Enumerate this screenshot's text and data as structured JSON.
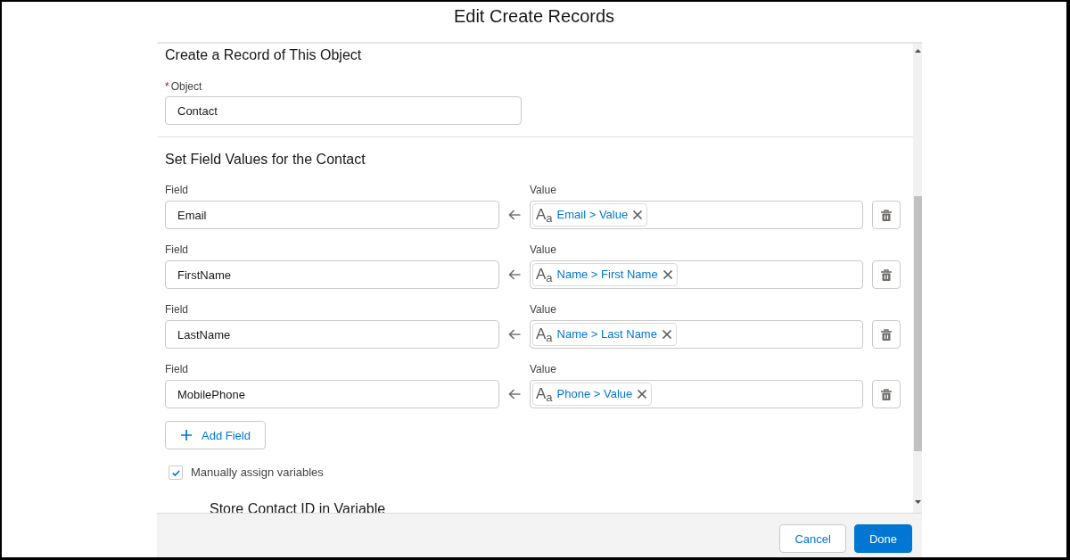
{
  "dialog": {
    "title": "Edit Create Records"
  },
  "record_section": {
    "heading": "Create a Record of This Object",
    "object_field": {
      "label": "Object",
      "required_mark": "*",
      "value": "Contact"
    }
  },
  "field_values_section": {
    "heading": "Set Field Values for the Contact",
    "rows": [
      {
        "field_label": "Field",
        "field": "Email",
        "value_label": "Value",
        "value": {
          "type_icon": "A$_{a}$",
          "reference": "Email > Value"
        }
      },
      {
        "field_label": "Field",
        "field": "FirstName",
        "value_label": "Value",
        "value": {
          "type_icon": "A$_{a}$",
          "reference": "Name > First Name"
        }
      },
      {
        "field_label": "Field",
        "field": "LastName",
        "value_label": "Value",
        "value": {
          "type_icon": "A$_{a}$",
          "reference": "Name > Last Name"
        }
      },
      {
        "field_label": "Field",
        "field": "MobilePhone",
        "value_label": "Value",
        "value": {
          "type_icon": "A$_{a}$",
          "reference": "Phone > Value"
        }
      }
    ],
    "add_button": "Add Field"
  },
  "manual_assign": {
    "label": "Manually assign variables",
    "checked": true
  },
  "variable_section": {
    "heading": "Store Contact ID in Variable"
  },
  "footer": {
    "buttons": [
      {
        "label": "Cancel",
        "kind": "neutral"
      },
      {
        "label": "Done",
        "kind": "brand"
      }
    ]
  }
}
